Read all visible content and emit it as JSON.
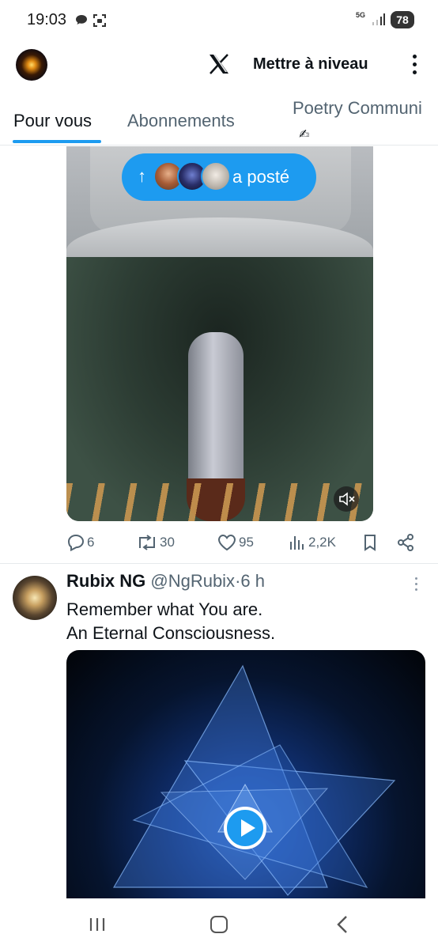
{
  "status_bar": {
    "time": "19:03",
    "network": "5G",
    "battery": "78",
    "icons": [
      "message-icon",
      "screenshot-icon",
      "signal-icon",
      "battery-icon"
    ]
  },
  "header": {
    "upgrade_label": "Mettre à niveau",
    "logo": "x-logo"
  },
  "tabs": [
    {
      "label": "Pour vous",
      "selected": true
    },
    {
      "label": "Abonnements",
      "selected": false
    },
    {
      "label": "Poetry Communi",
      "selected": false,
      "emoji": "✍"
    }
  ],
  "posted_pill": {
    "arrow": "↑",
    "label": "a posté"
  },
  "post1": {
    "media_type": "video",
    "muted": true,
    "actions": {
      "replies": "6",
      "reposts": "30",
      "likes": "95",
      "views": "2,2K"
    }
  },
  "post2": {
    "display_name": "Rubix NG",
    "handle": "@NgRubix",
    "separator": "·",
    "time": "6 h",
    "text_line1": "Remember what You are.",
    "text_line2": "An Eternal Consciousness.",
    "media_type": "video"
  },
  "colors": {
    "accent": "#1d9bf0",
    "text_primary": "#0f1419",
    "text_secondary": "#536471"
  }
}
